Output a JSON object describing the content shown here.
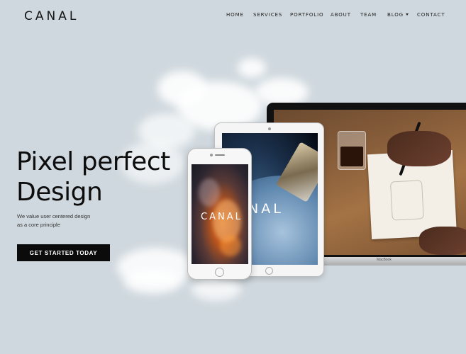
{
  "brand": {
    "logo": "CANAL"
  },
  "nav": {
    "items": [
      {
        "label": "HOME"
      },
      {
        "label": "SERVICES"
      },
      {
        "label": "PORTFOLIO"
      },
      {
        "label": "ABOUT"
      },
      {
        "label": "TEAM"
      },
      {
        "label": "BLOG",
        "has_dropdown": true
      },
      {
        "label": "CONTACT"
      }
    ]
  },
  "hero": {
    "title_line1": "Pixel perfect",
    "title_line2": "Design",
    "subtitle_line1": "We value user centered design",
    "subtitle_line2": "as a core principle",
    "cta_label": "GET STARTED TODAY"
  },
  "devices": {
    "laptop_brand": "MacBook",
    "tablet_screen_text": "ANAL",
    "phone_screen_text": "CANAL"
  },
  "colors": {
    "background": "#cfd8de",
    "text": "#0d0d0d",
    "cta_background": "#0b0b0b",
    "cta_text": "#ffffff"
  }
}
